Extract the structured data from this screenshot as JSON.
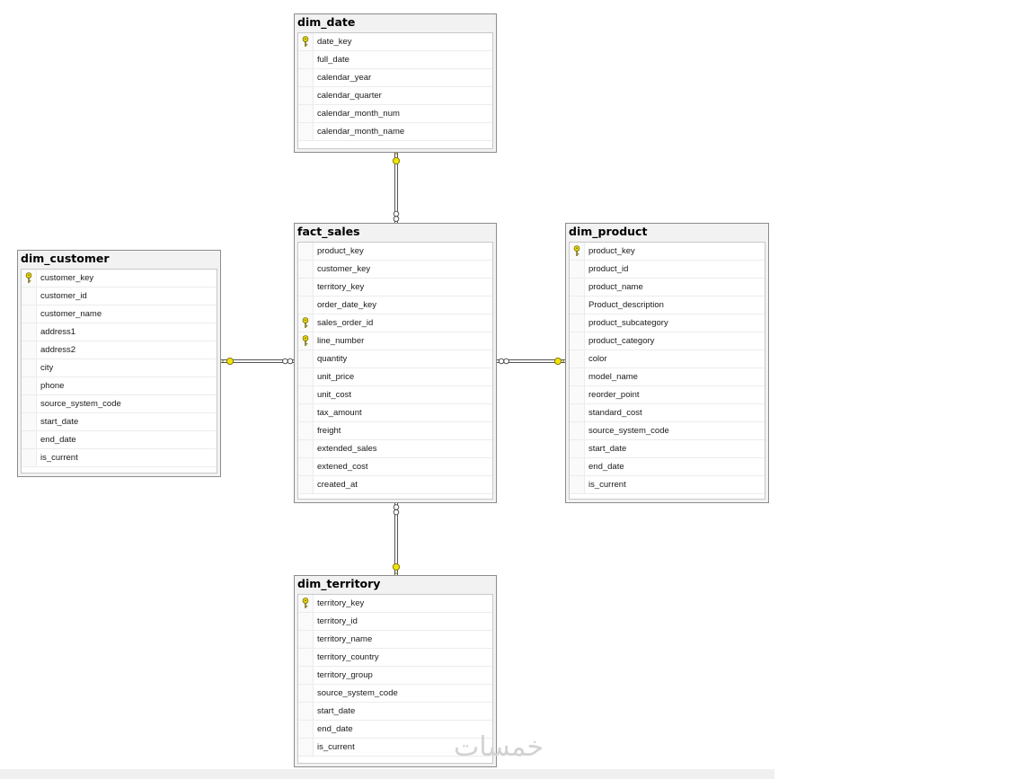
{
  "tables": {
    "dim_date": {
      "title": "dim_date",
      "columns": [
        {
          "name": "date_key",
          "pk": true
        },
        {
          "name": "full_date",
          "pk": false
        },
        {
          "name": "calendar_year",
          "pk": false
        },
        {
          "name": "calendar_quarter",
          "pk": false
        },
        {
          "name": "calendar_month_num",
          "pk": false
        },
        {
          "name": "calendar_month_name",
          "pk": false
        }
      ]
    },
    "fact_sales": {
      "title": "fact_sales",
      "columns": [
        {
          "name": "product_key",
          "pk": false
        },
        {
          "name": "customer_key",
          "pk": false
        },
        {
          "name": "territory_key",
          "pk": false
        },
        {
          "name": "order_date_key",
          "pk": false
        },
        {
          "name": "sales_order_id",
          "pk": true
        },
        {
          "name": "line_number",
          "pk": true
        },
        {
          "name": "quantity",
          "pk": false
        },
        {
          "name": "unit_price",
          "pk": false
        },
        {
          "name": "unit_cost",
          "pk": false
        },
        {
          "name": "tax_amount",
          "pk": false
        },
        {
          "name": "freight",
          "pk": false
        },
        {
          "name": "extended_sales",
          "pk": false
        },
        {
          "name": "extened_cost",
          "pk": false
        },
        {
          "name": "created_at",
          "pk": false
        }
      ]
    },
    "dim_customer": {
      "title": "dim_customer",
      "columns": [
        {
          "name": "customer_key",
          "pk": true
        },
        {
          "name": "customer_id",
          "pk": false
        },
        {
          "name": "customer_name",
          "pk": false
        },
        {
          "name": "address1",
          "pk": false
        },
        {
          "name": "address2",
          "pk": false
        },
        {
          "name": "city",
          "pk": false
        },
        {
          "name": "phone",
          "pk": false
        },
        {
          "name": "source_system_code",
          "pk": false
        },
        {
          "name": "start_date",
          "pk": false
        },
        {
          "name": "end_date",
          "pk": false
        },
        {
          "name": "is_current",
          "pk": false
        }
      ]
    },
    "dim_product": {
      "title": "dim_product",
      "columns": [
        {
          "name": "product_key",
          "pk": true
        },
        {
          "name": "product_id",
          "pk": false
        },
        {
          "name": "product_name",
          "pk": false
        },
        {
          "name": "Product_description",
          "pk": false
        },
        {
          "name": "product_subcategory",
          "pk": false
        },
        {
          "name": "product_category",
          "pk": false
        },
        {
          "name": "color",
          "pk": false
        },
        {
          "name": "model_name",
          "pk": false
        },
        {
          "name": "reorder_point",
          "pk": false
        },
        {
          "name": "standard_cost",
          "pk": false
        },
        {
          "name": "source_system_code",
          "pk": false
        },
        {
          "name": "start_date",
          "pk": false
        },
        {
          "name": "end_date",
          "pk": false
        },
        {
          "name": "is_current",
          "pk": false
        }
      ]
    },
    "dim_territory": {
      "title": "dim_territory",
      "columns": [
        {
          "name": "territory_key",
          "pk": true
        },
        {
          "name": "territory_id",
          "pk": false
        },
        {
          "name": "territory_name",
          "pk": false
        },
        {
          "name": "territory_country",
          "pk": false
        },
        {
          "name": "territory_group",
          "pk": false
        },
        {
          "name": "source_system_code",
          "pk": false
        },
        {
          "name": "start_date",
          "pk": false
        },
        {
          "name": "end_date",
          "pk": false
        },
        {
          "name": "is_current",
          "pk": false
        }
      ]
    }
  },
  "relationships": [
    {
      "one": "dim_date",
      "many": "fact_sales"
    },
    {
      "one": "dim_customer",
      "many": "fact_sales"
    },
    {
      "one": "dim_product",
      "many": "fact_sales"
    },
    {
      "one": "dim_territory",
      "many": "fact_sales"
    }
  ],
  "colors": {
    "key": "#f2e200",
    "key_outline": "#6b6400",
    "connector": "#555555"
  },
  "watermark": "خمسات"
}
